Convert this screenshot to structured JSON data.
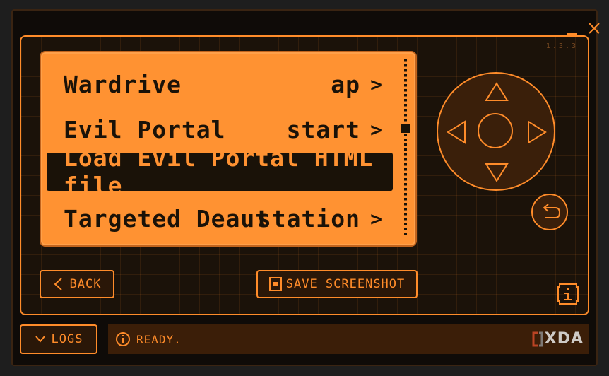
{
  "window": {
    "minimize_icon": "minimize-icon",
    "close_icon": "close-icon"
  },
  "device": {
    "version": "1.3.3"
  },
  "menu": {
    "items": [
      {
        "label": "Wardrive",
        "value": "ap",
        "chevron": ">"
      },
      {
        "label": "Evil Portal",
        "value": "start",
        "chevron": ">"
      },
      {
        "label": "Load Evil Portal HTML file",
        "value": "",
        "chevron": ""
      },
      {
        "label": "Targeted Deaut",
        "value": "station",
        "chevron": ">"
      }
    ],
    "selected_index": 2
  },
  "buttons": {
    "back_label": "BACK",
    "save_screenshot_label": "SAVE SCREENSHOT"
  },
  "footer": {
    "logs_label": "LOGS",
    "status_text": "READY.",
    "watermark": "XDA"
  },
  "colors": {
    "accent": "#ff8c2a",
    "screen": "#ff9232",
    "dark": "#1a1208"
  }
}
